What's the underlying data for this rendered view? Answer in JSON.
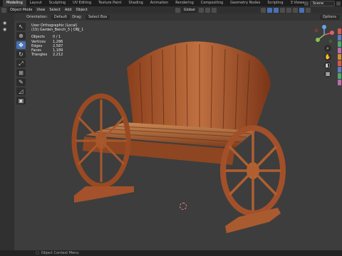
{
  "workspace_tabs": [
    "Modeling",
    "Layout",
    "Sculpting",
    "UV Editing",
    "Texture Paint",
    "Shading",
    "Animation",
    "Rendering",
    "Compositing",
    "Geometry Nodes",
    "Scripting",
    "3 Viewer"
  ],
  "active_tab_index": 0,
  "scene_name": "Scene",
  "header": {
    "mode": "Object Mode",
    "menus": [
      "View",
      "Select",
      "Add",
      "Object"
    ],
    "transform_orientation": "Global",
    "options_label": "Options"
  },
  "header2": {
    "orientation_label": "Orientation:",
    "orientation_value": "Default",
    "drag_label": "Drag:",
    "drag_value": "Select Box"
  },
  "overlay": {
    "view_name": "User Orthographic (Local)",
    "object_name": "(15) Garden_Bench_3 | OBJ_1",
    "stats": [
      {
        "label": "Objects",
        "value": "0 / 1"
      },
      {
        "label": "Vertices",
        "value": "1,286"
      },
      {
        "label": "Edges",
        "value": "2,587"
      },
      {
        "label": "Faces",
        "value": "1,189"
      },
      {
        "label": "Triangles",
        "value": "2,212"
      }
    ]
  },
  "status": {
    "text": "Object Context Menu"
  },
  "colors": {
    "accent": "#4772b3",
    "wood_light": "#b9683a",
    "wood_dark": "#6b2f17",
    "viewport_bg": "#3d3d3d"
  }
}
